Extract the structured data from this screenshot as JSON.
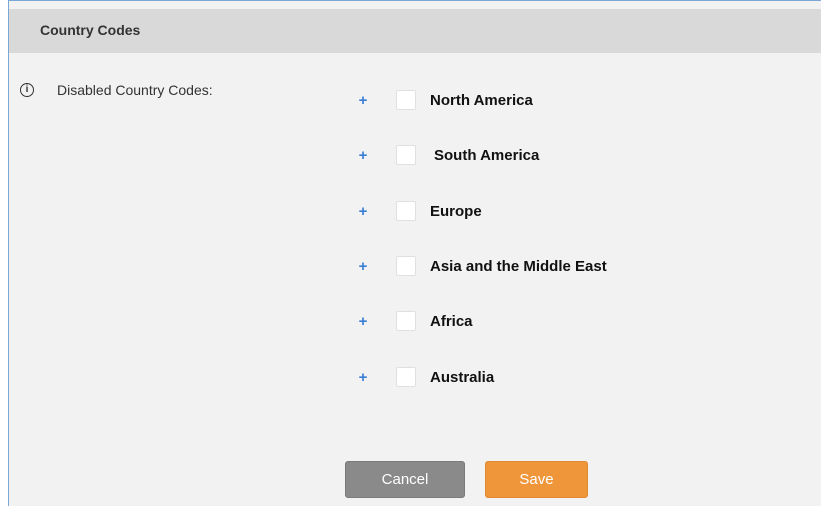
{
  "header": {
    "title": "Country Codes"
  },
  "field": {
    "label": "Disabled Country Codes:",
    "info_icon": "i"
  },
  "regions": [
    {
      "label": "North America",
      "expand": "+",
      "checked": false
    },
    {
      "label": "South America",
      "expand": "+",
      "checked": false
    },
    {
      "label": "Europe",
      "expand": "+",
      "checked": false
    },
    {
      "label": "Asia and the Middle East",
      "expand": "+",
      "checked": false
    },
    {
      "label": "Africa",
      "expand": "+",
      "checked": false
    },
    {
      "label": "Australia",
      "expand": "+",
      "checked": false
    }
  ],
  "buttons": {
    "cancel_label": "Cancel",
    "save_label": "Save"
  },
  "colors": {
    "header_bg": "#d9d9d9",
    "panel_bg": "#f2f2f2",
    "plus": "#3a7fd6",
    "cancel_bg": "#8a8a8a",
    "save_bg": "#f0963a"
  }
}
